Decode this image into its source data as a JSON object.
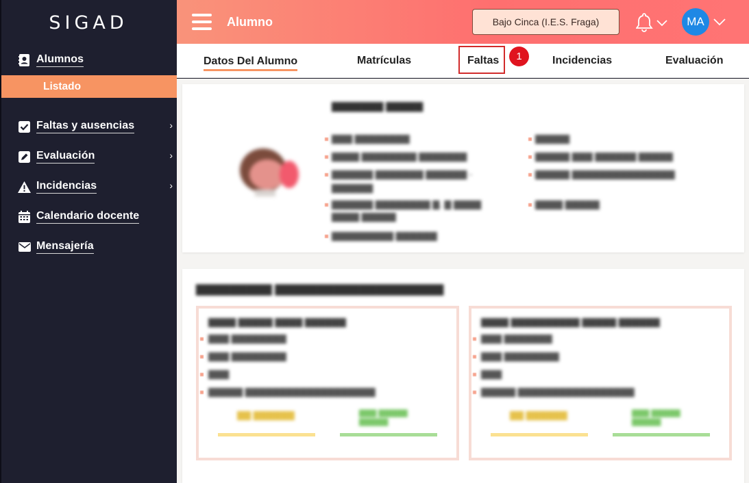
{
  "app": {
    "brand": "SIGAD",
    "module_title": "Alumno",
    "center_label": "Bajo Cinca (I.E.S. Fraga)",
    "avatar_initials": "MA",
    "accent_color": "#f79462",
    "header_gradient": [
      "#f9937a",
      "#ff7474"
    ]
  },
  "sidebar": {
    "items": [
      {
        "label": "Alumnos",
        "icon": "contact-book-icon",
        "has_submenu": false
      },
      {
        "label": "Faltas y ausencias",
        "icon": "checkbox-icon",
        "has_submenu": true
      },
      {
        "label": "Evaluación",
        "icon": "edit-icon",
        "has_submenu": true
      },
      {
        "label": "Incidencias",
        "icon": "warning-icon",
        "has_submenu": true
      },
      {
        "label": "Calendario docente",
        "icon": "calendar-icon",
        "has_submenu": false
      },
      {
        "label": "Mensajería",
        "icon": "envelope-icon",
        "has_submenu": false
      }
    ],
    "active_subitem": "Listado"
  },
  "tabs": {
    "items": [
      "Datos Del Alumno",
      "Matrículas",
      "Faltas",
      "Incidencias",
      "Evaluación"
    ],
    "active": "Datos Del Alumno",
    "highlighted": "Faltas",
    "step_badge": "1"
  }
}
